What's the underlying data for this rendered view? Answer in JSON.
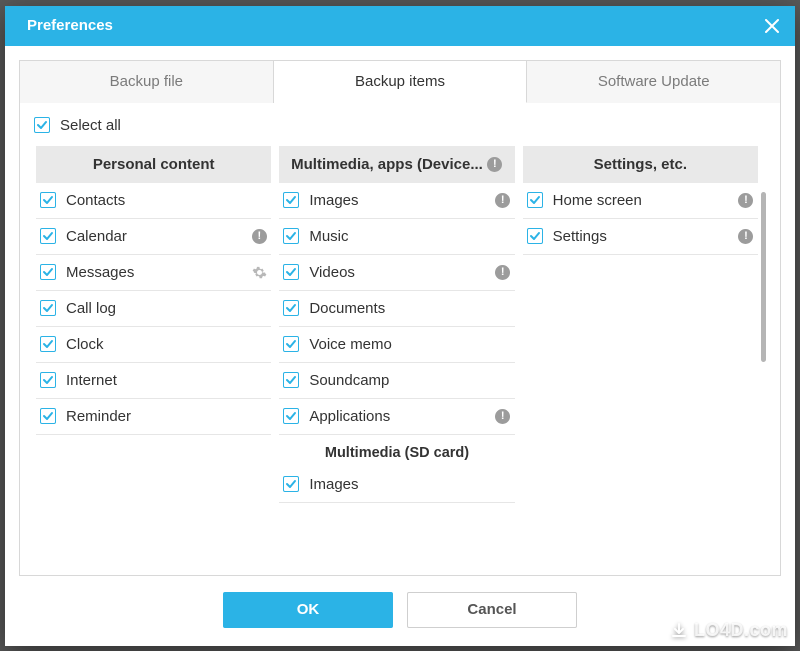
{
  "window": {
    "title": "Preferences"
  },
  "tabs": [
    {
      "label": "Backup file",
      "active": false
    },
    {
      "label": "Backup items",
      "active": true
    },
    {
      "label": "Software Update",
      "active": false
    }
  ],
  "select_all": {
    "label": "Select all",
    "checked": true
  },
  "columns": {
    "personal": {
      "header": "Personal content",
      "items": [
        {
          "label": "Contacts",
          "checked": true,
          "info": false,
          "gear": false
        },
        {
          "label": "Calendar",
          "checked": true,
          "info": true,
          "gear": false
        },
        {
          "label": "Messages",
          "checked": true,
          "info": false,
          "gear": true
        },
        {
          "label": "Call log",
          "checked": true,
          "info": false,
          "gear": false
        },
        {
          "label": "Clock",
          "checked": true,
          "info": false,
          "gear": false
        },
        {
          "label": "Internet",
          "checked": true,
          "info": false,
          "gear": false
        },
        {
          "label": "Reminder",
          "checked": true,
          "info": false,
          "gear": false
        }
      ]
    },
    "multimedia": {
      "header": "Multimedia, apps (Device...",
      "header_info": true,
      "items": [
        {
          "label": "Images",
          "checked": true,
          "info": true,
          "gear": false
        },
        {
          "label": "Music",
          "checked": true,
          "info": false,
          "gear": false
        },
        {
          "label": "Videos",
          "checked": true,
          "info": true,
          "gear": false
        },
        {
          "label": "Documents",
          "checked": true,
          "info": false,
          "gear": false
        },
        {
          "label": "Voice memo",
          "checked": true,
          "info": false,
          "gear": false
        },
        {
          "label": "Soundcamp",
          "checked": true,
          "info": false,
          "gear": false
        },
        {
          "label": "Applications",
          "checked": true,
          "info": true,
          "gear": false
        }
      ],
      "subheader": "Multimedia (SD card)",
      "sd_items": [
        {
          "label": "Images",
          "checked": true,
          "info": false,
          "gear": false
        }
      ]
    },
    "settings": {
      "header": "Settings, etc.",
      "items": [
        {
          "label": "Home screen",
          "checked": true,
          "info": true,
          "gear": false
        },
        {
          "label": "Settings",
          "checked": true,
          "info": true,
          "gear": false
        }
      ]
    }
  },
  "footer": {
    "ok": "OK",
    "cancel": "Cancel"
  },
  "watermark": "LO4D.com"
}
